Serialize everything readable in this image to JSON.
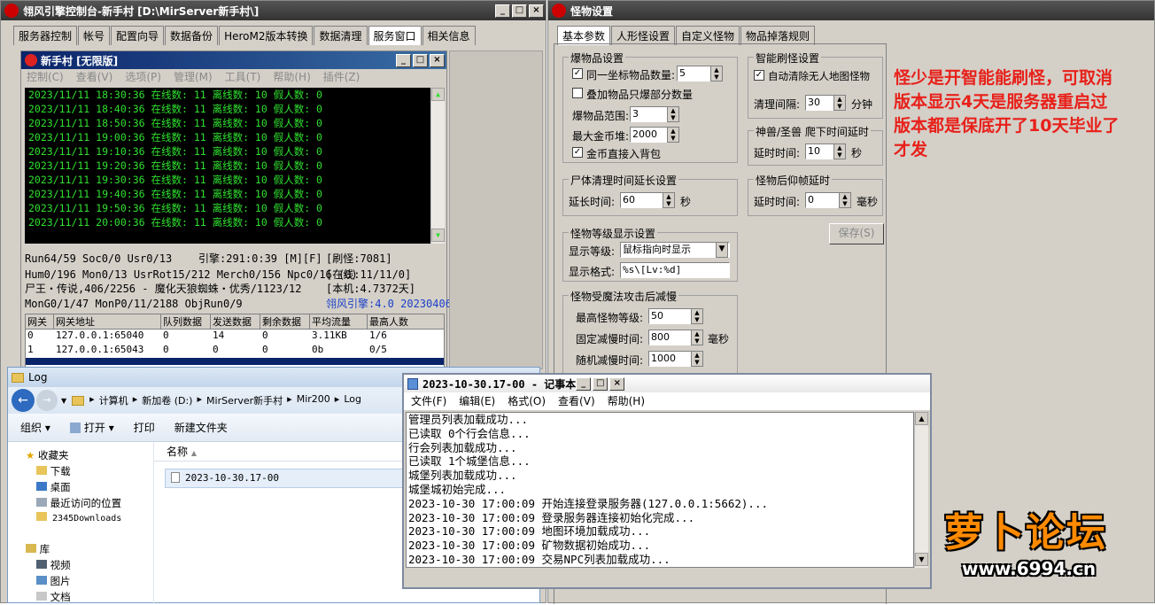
{
  "main": {
    "title": "翎风引擎控制台-新手村 [D:\\MirServer新手村\\]",
    "tabs": [
      "服务器控制",
      "帐号",
      "配置向导",
      "数据备份",
      "HeroM2版本转换",
      "数据清理",
      "服务窗口",
      "相关信息"
    ],
    "inner": {
      "title": "新手村 [无限版]",
      "menu": [
        "控制(C)",
        "查看(V)",
        "选项(P)",
        "管理(M)",
        "工具(T)",
        "帮助(H)",
        "插件(Z)"
      ],
      "log": [
        "2023/11/11 18:30:36 在线数: 11 离线数: 10 假人数: 0",
        "2023/11/11 18:40:36 在线数: 11 离线数: 10 假人数: 0",
        "2023/11/11 18:50:36 在线数: 11 离线数: 10 假人数: 0",
        "2023/11/11 19:00:36 在线数: 11 离线数: 10 假人数: 0",
        "2023/11/11 19:10:36 在线数: 11 离线数: 10 假人数: 0",
        "2023/11/11 19:20:36 在线数: 11 离线数: 10 假人数: 0",
        "2023/11/11 19:30:36 在线数: 11 离线数: 10 假人数: 0",
        "2023/11/11 19:40:36 在线数: 11 离线数: 10 假人数: 0",
        "2023/11/11 19:50:36 在线数: 11 离线数: 10 假人数: 0",
        "2023/11/11 20:00:36 在线数: 11 离线数: 10 假人数: 0"
      ],
      "status": {
        "a1": "Run64/59 Soc0/0 Usr0/13",
        "a2": "引擎:291:0:39 [M][F]",
        "a3": "[刷怪:7081]",
        "b1": "Hum0/196 Mon0/13 UsrRot15/212 Merch0/156 Npc0/16 (0)",
        "b3": "[在线:11/11/0]",
        "c1": "尸王・传说,406/2256 - 魔化天狼蜘蛛・优秀/1123/12",
        "c3": "[本机:4.7372天]",
        "d1": "MonG0/1/47 MonP0/11/2188 ObjRun0/9",
        "d3": "翎风引擎:4.0 20230406"
      },
      "table": {
        "headers": [
          "网关",
          "网关地址",
          "队列数据",
          "发送数据",
          "剩余数据",
          "平均流量",
          "最高人数"
        ],
        "rows": [
          [
            "0",
            "127.0.0.1:65040",
            "0",
            "14",
            "0",
            "3.11KB",
            "1/6"
          ],
          [
            "1",
            "127.0.0.1:65043",
            "0",
            "0",
            "0",
            "0b",
            "0/5"
          ]
        ]
      }
    }
  },
  "monster": {
    "title": "怪物设置",
    "tabs": [
      "基本参数",
      "人形怪设置",
      "自定义怪物",
      "物品掉落规则"
    ],
    "drop": {
      "title": "爆物品设置",
      "same_coord": "同一坐标物品数量:",
      "same_val": "5",
      "partial": "叠加物品只爆部分数量",
      "range": "爆物品范围:",
      "range_val": "3",
      "gold": "最大金币堆:",
      "gold_val": "2000",
      "gold_bag": "金币直接入背包"
    },
    "smart": {
      "title": "智能刷怪设置",
      "auto_clear": "自动清除无人地图怪物",
      "interval": "清理间隔:",
      "interval_val": "30",
      "unit": "分钟"
    },
    "beast": {
      "title": "神兽/圣兽 爬下时间延时",
      "delay": "延时时间:",
      "delay_val": "10",
      "unit": "秒"
    },
    "corpse": {
      "title": "尸体清理时间延长设置",
      "delay": "延长时间:",
      "delay_val": "60",
      "unit": "秒"
    },
    "fall": {
      "title": "怪物后仰帧延时",
      "delay": "延时时间:",
      "delay_val": "0",
      "unit": "毫秒"
    },
    "save": "保存(S)",
    "level": {
      "title": "怪物等级显示设置",
      "show": "显示等级:",
      "show_val": "鼠标指向时显示",
      "format": "显示格式:",
      "format_val": "%s\\[Lv:%d]"
    },
    "slow": {
      "title": "怪物受魔法攻击后减慢",
      "max": "最高怪物等级:",
      "max_val": "50",
      "fixed": "固定减慢时间:",
      "fixed_val": "800",
      "fixed_unit": "毫秒",
      "rand": "随机减慢时间:",
      "rand_val": "1000"
    }
  },
  "note": [
    "怪少是开智能能刷怪，可取消",
    "版本显示4天是服务器重启过",
    "版本都是保底开了10天毕业了",
    "才发"
  ],
  "explorer": {
    "title": "Log",
    "path": [
      "计算机",
      "新加卷 (D:)",
      "MirServer新手村",
      "Mir200",
      "Log"
    ],
    "toolbar": [
      "组织",
      "打开",
      "打印",
      "新建文件夹"
    ],
    "col": "名称",
    "file": "2023-10-30.17-00",
    "tree": [
      {
        "label": "收藏夹",
        "icon": "star-icon"
      },
      {
        "label": "下载",
        "icon": "folder-icon"
      },
      {
        "label": "桌面",
        "icon": "desktop-icon"
      },
      {
        "label": "最近访问的位置",
        "icon": "recent-icon"
      },
      {
        "label": "2345Downloads",
        "icon": "folder-icon"
      },
      {
        "label": "库",
        "icon": "library-icon"
      },
      {
        "label": "视频",
        "icon": "video-icon"
      },
      {
        "label": "图片",
        "icon": "picture-icon"
      },
      {
        "label": "文档",
        "icon": "document-icon"
      }
    ]
  },
  "notepad": {
    "title": "2023-10-30.17-00 - 记事本",
    "menu": [
      "文件(F)",
      "编辑(E)",
      "格式(O)",
      "查看(V)",
      "帮助(H)"
    ],
    "lines": [
      "管理员列表加载成功...",
      "已读取 0个行会信息...",
      "行会列表加载成功...",
      "已读取 1个城堡信息...",
      "城堡列表加载成功...",
      "城堡城初始完成...",
      "2023-10-30 17:00:09 开始连接登录服务器(127.0.0.1:5662)...",
      "2023-10-30 17:00:09 登录服务器连接初始化完成...",
      "2023-10-30 17:00:09 地图环境加载成功...",
      "2023-10-30 17:00:09 矿物数据初始成功...",
      "2023-10-30 17:00:09 交易NPC列表加载成功..."
    ]
  },
  "watermark": {
    "logo": "萝卜论坛",
    "url": "www.6994.cn"
  }
}
